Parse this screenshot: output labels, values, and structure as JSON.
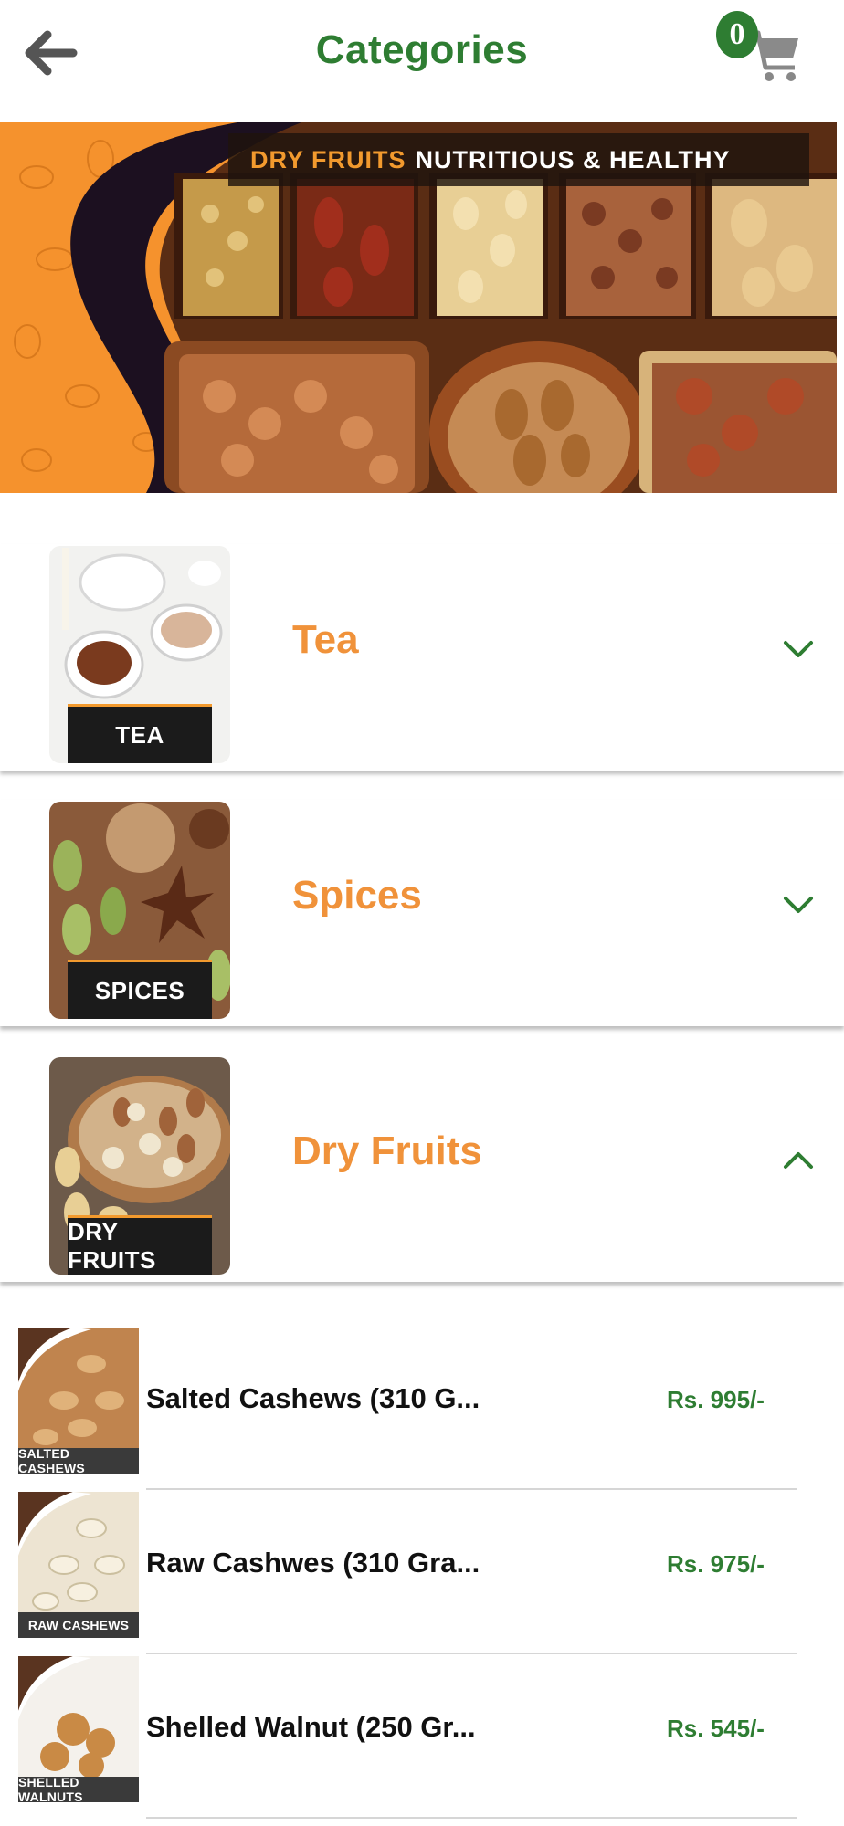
{
  "header": {
    "title": "Categories",
    "back_icon": "arrow-left-icon",
    "cart_icon": "cart-icon",
    "cart_count": "0"
  },
  "banner": {
    "tagline_accent": "DRY FRUITS",
    "tagline_rest": "NUTRITIOUS & HEALTHY",
    "accent_color": "#f29a2e"
  },
  "categories": [
    {
      "name": "Tea",
      "thumb_label": "TEA",
      "expanded": false
    },
    {
      "name": "Spices",
      "thumb_label": "SPICES",
      "expanded": false
    },
    {
      "name": "Dry Fruits",
      "thumb_label": "DRY FRUITS",
      "expanded": true
    }
  ],
  "products": [
    {
      "name": "Salted Cashews (310 G...",
      "price": "Rs. 995/-",
      "thumb_label": "SALTED CASHEWS"
    },
    {
      "name": "Raw Cashwes (310 Gra...",
      "price": "Rs. 975/-",
      "thumb_label": "RAW CASHEWS"
    },
    {
      "name": "Shelled Walnut (250 Gr...",
      "price": "Rs. 545/-",
      "thumb_label": "SHELLED WALNUTS"
    }
  ],
  "colors": {
    "brand_green": "#2e7d32",
    "category_orange": "#f0923a",
    "banner_orange": "#f5922d"
  }
}
